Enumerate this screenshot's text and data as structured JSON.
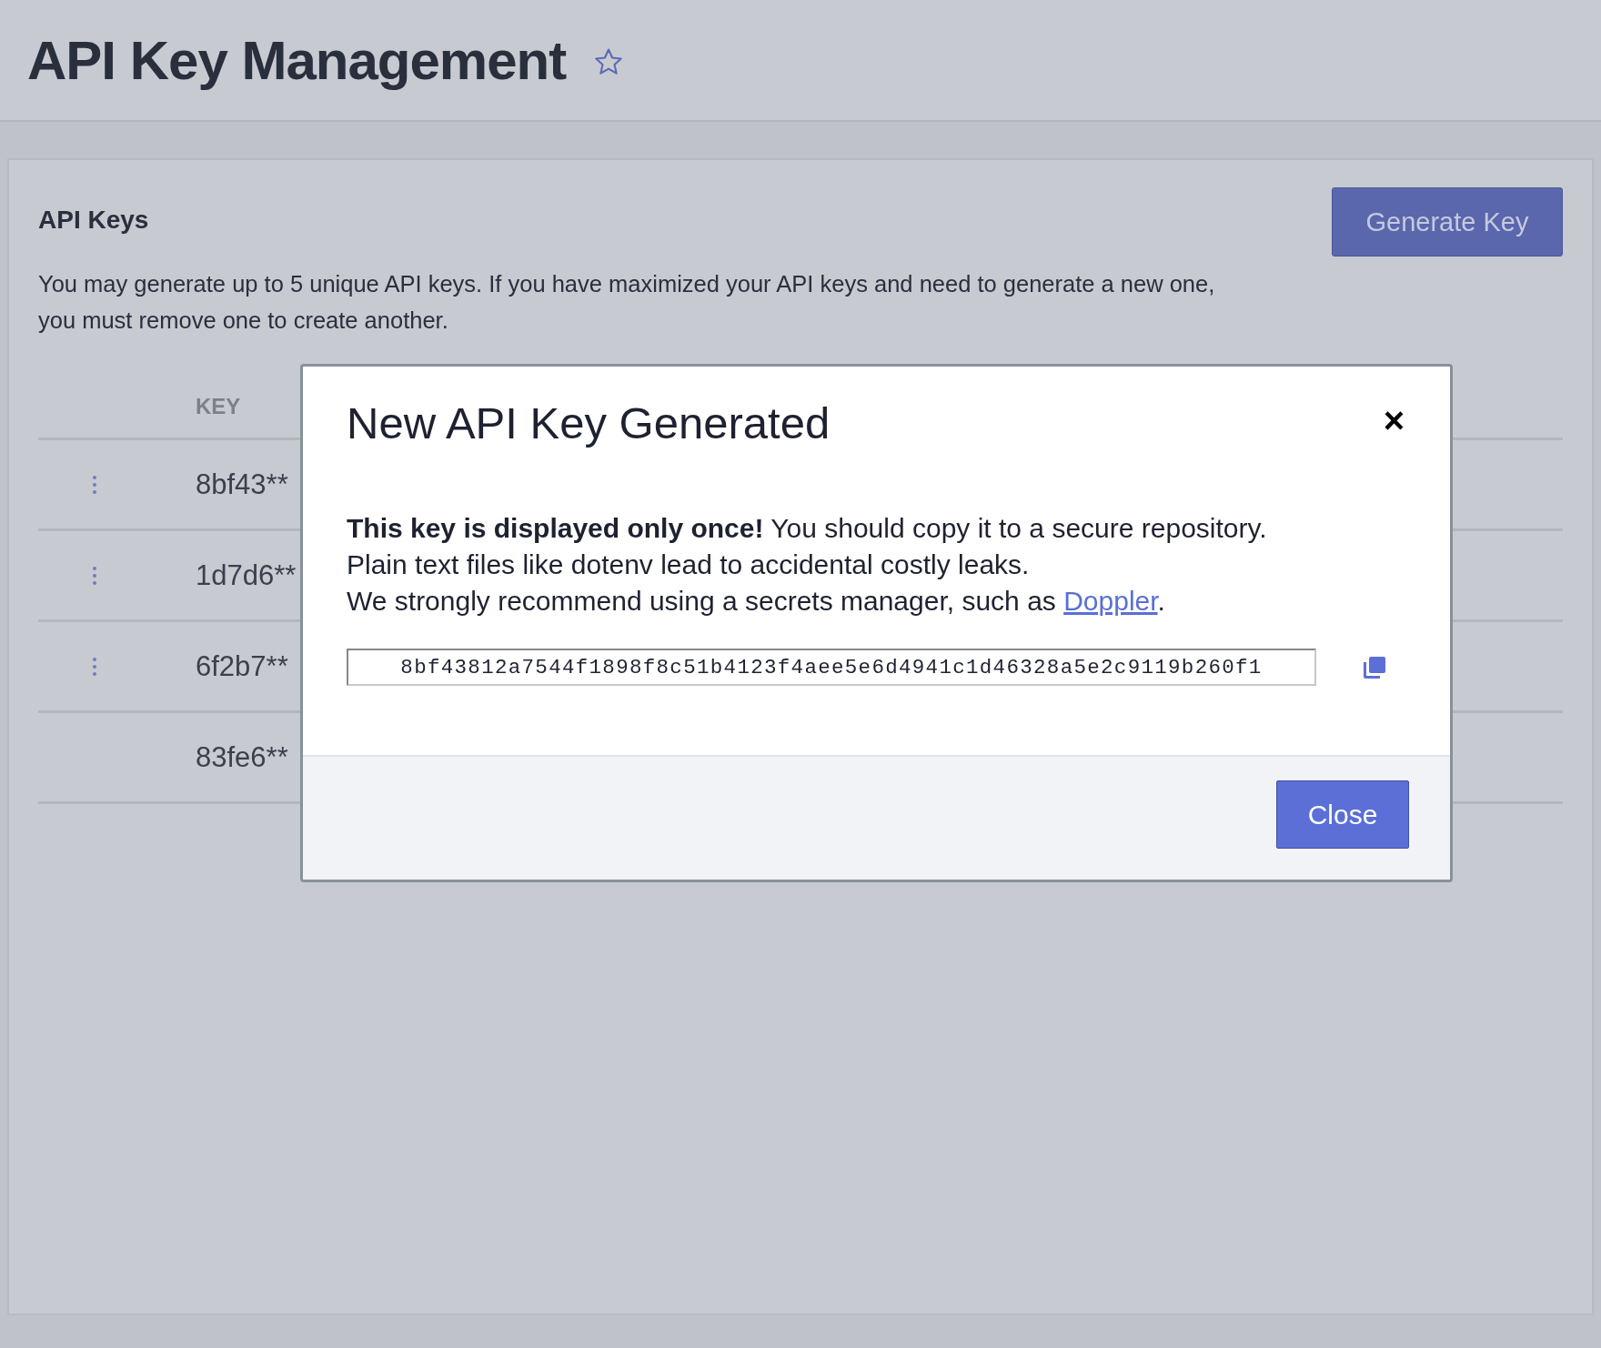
{
  "page": {
    "title": "API Key Management",
    "favorite": false
  },
  "card": {
    "title": "API Keys",
    "generate_button": "Generate Key",
    "description": "You may generate up to 5 unique API keys. If you have maximized your API keys and need to generate a new one, you must remove one to create another."
  },
  "table": {
    "columns": [
      "KEY"
    ],
    "rows": [
      {
        "key": "8bf43**",
        "has_menu": true
      },
      {
        "key": "1d7d6**",
        "has_menu": true
      },
      {
        "key": "6f2b7**",
        "has_menu": true
      },
      {
        "key": "83fe6**",
        "has_menu": false
      }
    ]
  },
  "modal": {
    "title": "New API Key Generated",
    "close_icon": "×",
    "message": [
      "**This key is displayed only once!** You should copy it to a secure repository.",
      "Plain text files like dotenv lead to accidental costly leaks."
    ],
    "recommend_text": "We strongly recommend using a secrets manager, such as ",
    "link": "Doppler",
    "after_link": ".",
    "key_value": "8bf43812a7544f1898f8c51b4123f4aee5e6d4941c1d46328a5e2c9119b260f1",
    "close_button": "Close"
  }
}
